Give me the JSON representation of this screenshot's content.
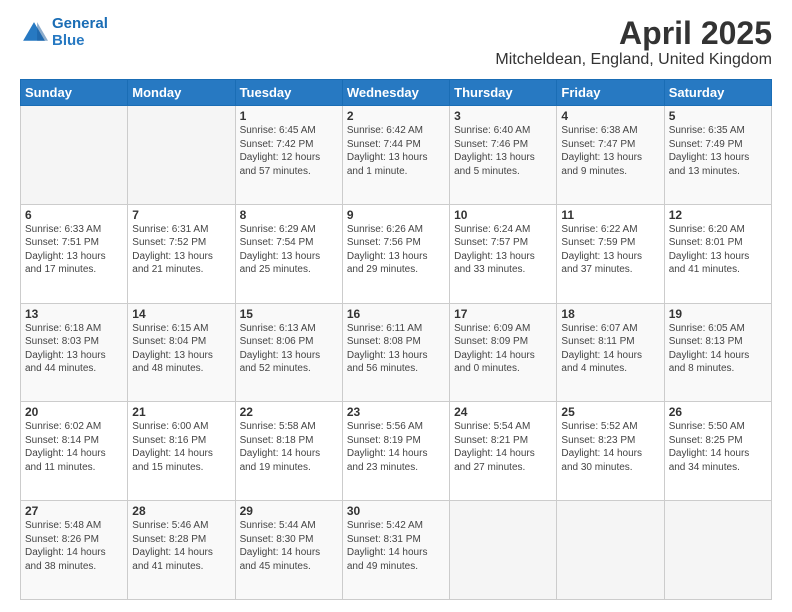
{
  "header": {
    "logo_line1": "General",
    "logo_line2": "Blue",
    "title": "April 2025",
    "subtitle": "Mitcheldean, England, United Kingdom"
  },
  "weekdays": [
    "Sunday",
    "Monday",
    "Tuesday",
    "Wednesday",
    "Thursday",
    "Friday",
    "Saturday"
  ],
  "weeks": [
    [
      {
        "day": "",
        "sunrise": "",
        "sunset": "",
        "daylight": ""
      },
      {
        "day": "",
        "sunrise": "",
        "sunset": "",
        "daylight": ""
      },
      {
        "day": "1",
        "sunrise": "Sunrise: 6:45 AM",
        "sunset": "Sunset: 7:42 PM",
        "daylight": "Daylight: 12 hours and 57 minutes."
      },
      {
        "day": "2",
        "sunrise": "Sunrise: 6:42 AM",
        "sunset": "Sunset: 7:44 PM",
        "daylight": "Daylight: 13 hours and 1 minute."
      },
      {
        "day": "3",
        "sunrise": "Sunrise: 6:40 AM",
        "sunset": "Sunset: 7:46 PM",
        "daylight": "Daylight: 13 hours and 5 minutes."
      },
      {
        "day": "4",
        "sunrise": "Sunrise: 6:38 AM",
        "sunset": "Sunset: 7:47 PM",
        "daylight": "Daylight: 13 hours and 9 minutes."
      },
      {
        "day": "5",
        "sunrise": "Sunrise: 6:35 AM",
        "sunset": "Sunset: 7:49 PM",
        "daylight": "Daylight: 13 hours and 13 minutes."
      }
    ],
    [
      {
        "day": "6",
        "sunrise": "Sunrise: 6:33 AM",
        "sunset": "Sunset: 7:51 PM",
        "daylight": "Daylight: 13 hours and 17 minutes."
      },
      {
        "day": "7",
        "sunrise": "Sunrise: 6:31 AM",
        "sunset": "Sunset: 7:52 PM",
        "daylight": "Daylight: 13 hours and 21 minutes."
      },
      {
        "day": "8",
        "sunrise": "Sunrise: 6:29 AM",
        "sunset": "Sunset: 7:54 PM",
        "daylight": "Daylight: 13 hours and 25 minutes."
      },
      {
        "day": "9",
        "sunrise": "Sunrise: 6:26 AM",
        "sunset": "Sunset: 7:56 PM",
        "daylight": "Daylight: 13 hours and 29 minutes."
      },
      {
        "day": "10",
        "sunrise": "Sunrise: 6:24 AM",
        "sunset": "Sunset: 7:57 PM",
        "daylight": "Daylight: 13 hours and 33 minutes."
      },
      {
        "day": "11",
        "sunrise": "Sunrise: 6:22 AM",
        "sunset": "Sunset: 7:59 PM",
        "daylight": "Daylight: 13 hours and 37 minutes."
      },
      {
        "day": "12",
        "sunrise": "Sunrise: 6:20 AM",
        "sunset": "Sunset: 8:01 PM",
        "daylight": "Daylight: 13 hours and 41 minutes."
      }
    ],
    [
      {
        "day": "13",
        "sunrise": "Sunrise: 6:18 AM",
        "sunset": "Sunset: 8:03 PM",
        "daylight": "Daylight: 13 hours and 44 minutes."
      },
      {
        "day": "14",
        "sunrise": "Sunrise: 6:15 AM",
        "sunset": "Sunset: 8:04 PM",
        "daylight": "Daylight: 13 hours and 48 minutes."
      },
      {
        "day": "15",
        "sunrise": "Sunrise: 6:13 AM",
        "sunset": "Sunset: 8:06 PM",
        "daylight": "Daylight: 13 hours and 52 minutes."
      },
      {
        "day": "16",
        "sunrise": "Sunrise: 6:11 AM",
        "sunset": "Sunset: 8:08 PM",
        "daylight": "Daylight: 13 hours and 56 minutes."
      },
      {
        "day": "17",
        "sunrise": "Sunrise: 6:09 AM",
        "sunset": "Sunset: 8:09 PM",
        "daylight": "Daylight: 14 hours and 0 minutes."
      },
      {
        "day": "18",
        "sunrise": "Sunrise: 6:07 AM",
        "sunset": "Sunset: 8:11 PM",
        "daylight": "Daylight: 14 hours and 4 minutes."
      },
      {
        "day": "19",
        "sunrise": "Sunrise: 6:05 AM",
        "sunset": "Sunset: 8:13 PM",
        "daylight": "Daylight: 14 hours and 8 minutes."
      }
    ],
    [
      {
        "day": "20",
        "sunrise": "Sunrise: 6:02 AM",
        "sunset": "Sunset: 8:14 PM",
        "daylight": "Daylight: 14 hours and 11 minutes."
      },
      {
        "day": "21",
        "sunrise": "Sunrise: 6:00 AM",
        "sunset": "Sunset: 8:16 PM",
        "daylight": "Daylight: 14 hours and 15 minutes."
      },
      {
        "day": "22",
        "sunrise": "Sunrise: 5:58 AM",
        "sunset": "Sunset: 8:18 PM",
        "daylight": "Daylight: 14 hours and 19 minutes."
      },
      {
        "day": "23",
        "sunrise": "Sunrise: 5:56 AM",
        "sunset": "Sunset: 8:19 PM",
        "daylight": "Daylight: 14 hours and 23 minutes."
      },
      {
        "day": "24",
        "sunrise": "Sunrise: 5:54 AM",
        "sunset": "Sunset: 8:21 PM",
        "daylight": "Daylight: 14 hours and 27 minutes."
      },
      {
        "day": "25",
        "sunrise": "Sunrise: 5:52 AM",
        "sunset": "Sunset: 8:23 PM",
        "daylight": "Daylight: 14 hours and 30 minutes."
      },
      {
        "day": "26",
        "sunrise": "Sunrise: 5:50 AM",
        "sunset": "Sunset: 8:25 PM",
        "daylight": "Daylight: 14 hours and 34 minutes."
      }
    ],
    [
      {
        "day": "27",
        "sunrise": "Sunrise: 5:48 AM",
        "sunset": "Sunset: 8:26 PM",
        "daylight": "Daylight: 14 hours and 38 minutes."
      },
      {
        "day": "28",
        "sunrise": "Sunrise: 5:46 AM",
        "sunset": "Sunset: 8:28 PM",
        "daylight": "Daylight: 14 hours and 41 minutes."
      },
      {
        "day": "29",
        "sunrise": "Sunrise: 5:44 AM",
        "sunset": "Sunset: 8:30 PM",
        "daylight": "Daylight: 14 hours and 45 minutes."
      },
      {
        "day": "30",
        "sunrise": "Sunrise: 5:42 AM",
        "sunset": "Sunset: 8:31 PM",
        "daylight": "Daylight: 14 hours and 49 minutes."
      },
      {
        "day": "",
        "sunrise": "",
        "sunset": "",
        "daylight": ""
      },
      {
        "day": "",
        "sunrise": "",
        "sunset": "",
        "daylight": ""
      },
      {
        "day": "",
        "sunrise": "",
        "sunset": "",
        "daylight": ""
      }
    ]
  ]
}
